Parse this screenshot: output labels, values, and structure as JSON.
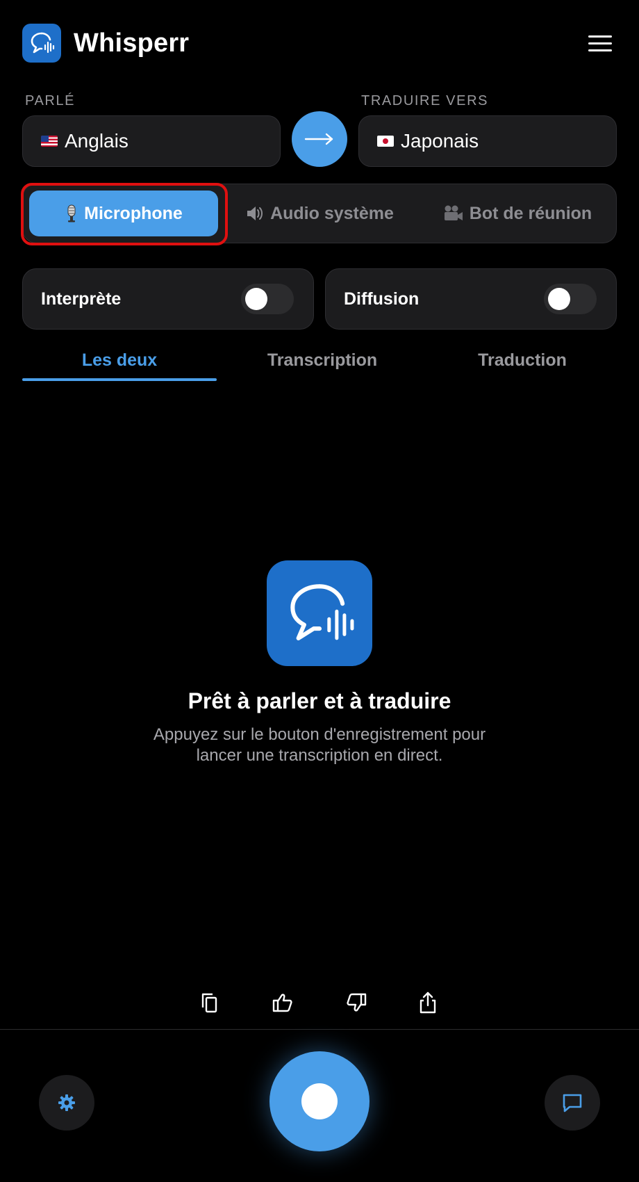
{
  "app": {
    "title": "Whisperr",
    "brand_color": "#1e6fc9",
    "accent_color": "#4a9ee8",
    "menu_icon": "hamburger-menu-icon"
  },
  "languages": {
    "spoken_label": "PARLÉ",
    "target_label": "TRADUIRE VERS",
    "spoken_value": "Anglais",
    "target_value": "Japonais",
    "spoken_flag": "us-flag-icon",
    "target_flag": "japan-flag-icon",
    "swap_icon": "arrow-right-icon"
  },
  "source": {
    "options": [
      {
        "label": "Microphone",
        "icon": "microphone-icon",
        "active": true
      },
      {
        "label": "Audio système",
        "icon": "speaker-icon",
        "active": false
      },
      {
        "label": "Bot de réunion",
        "icon": "video-camera-icon",
        "active": false
      }
    ]
  },
  "toggles": [
    {
      "label": "Interprète",
      "on": false
    },
    {
      "label": "Diffusion",
      "on": false
    }
  ],
  "tabs": [
    {
      "label": "Les deux",
      "active": true
    },
    {
      "label": "Transcription",
      "active": false
    },
    {
      "label": "Traduction",
      "active": false
    }
  ],
  "empty_state": {
    "icon": "speech-bubble-waveform-icon",
    "title": "Prêt à parler et à traduire",
    "subtitle": "Appuyez sur le bouton d'enregistrement pour lancer une transcription en direct."
  },
  "actions": [
    "copy-icon",
    "thumbs-up-icon",
    "thumbs-down-icon",
    "share-icon"
  ],
  "bottom_bar": {
    "settings_icon": "gear-icon",
    "record_icon": "record-icon",
    "chat_icon": "chat-icon"
  }
}
